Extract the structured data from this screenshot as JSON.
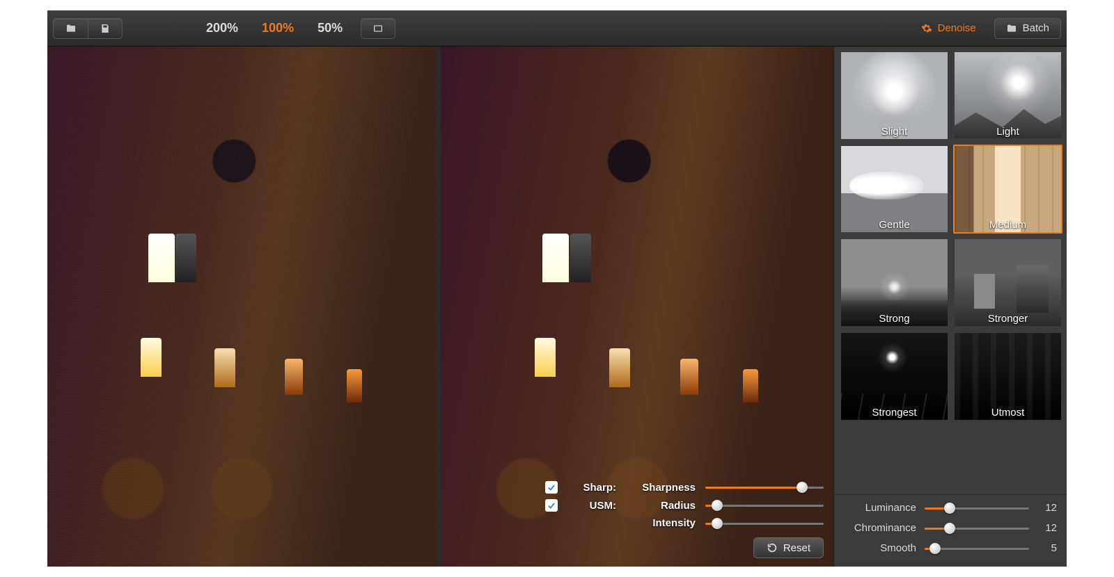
{
  "toolbar": {
    "zoom": {
      "levels": [
        "200%",
        "100%",
        "50%"
      ],
      "active": "100%"
    },
    "tabs": {
      "denoise": "Denoise",
      "batch": "Batch",
      "active": "denoise"
    }
  },
  "overlay": {
    "sharp_checkbox_label": "Sharp:",
    "usm_checkbox_label": "USM:",
    "rows": [
      {
        "label": "Sharpness",
        "percent": 82
      },
      {
        "label": "Radius",
        "percent": 10
      },
      {
        "label": "Intensity",
        "percent": 10
      }
    ],
    "sharp_checked": true,
    "usm_checked": true,
    "reset_label": "Reset"
  },
  "presets": {
    "items": [
      {
        "key": "slight",
        "label": "Slight"
      },
      {
        "key": "light",
        "label": "Light"
      },
      {
        "key": "gentle",
        "label": "Gentle"
      },
      {
        "key": "medium",
        "label": "Medium"
      },
      {
        "key": "strong",
        "label": "Strong"
      },
      {
        "key": "stronger",
        "label": "Stronger"
      },
      {
        "key": "strongest",
        "label": "Strongest"
      },
      {
        "key": "utmost",
        "label": "Utmost"
      }
    ],
    "selected": "medium"
  },
  "side_sliders": [
    {
      "label": "Luminance",
      "value": 12,
      "max": 50
    },
    {
      "label": "Chrominance",
      "value": 12,
      "max": 50
    },
    {
      "label": "Smooth",
      "value": 5,
      "max": 50
    }
  ]
}
